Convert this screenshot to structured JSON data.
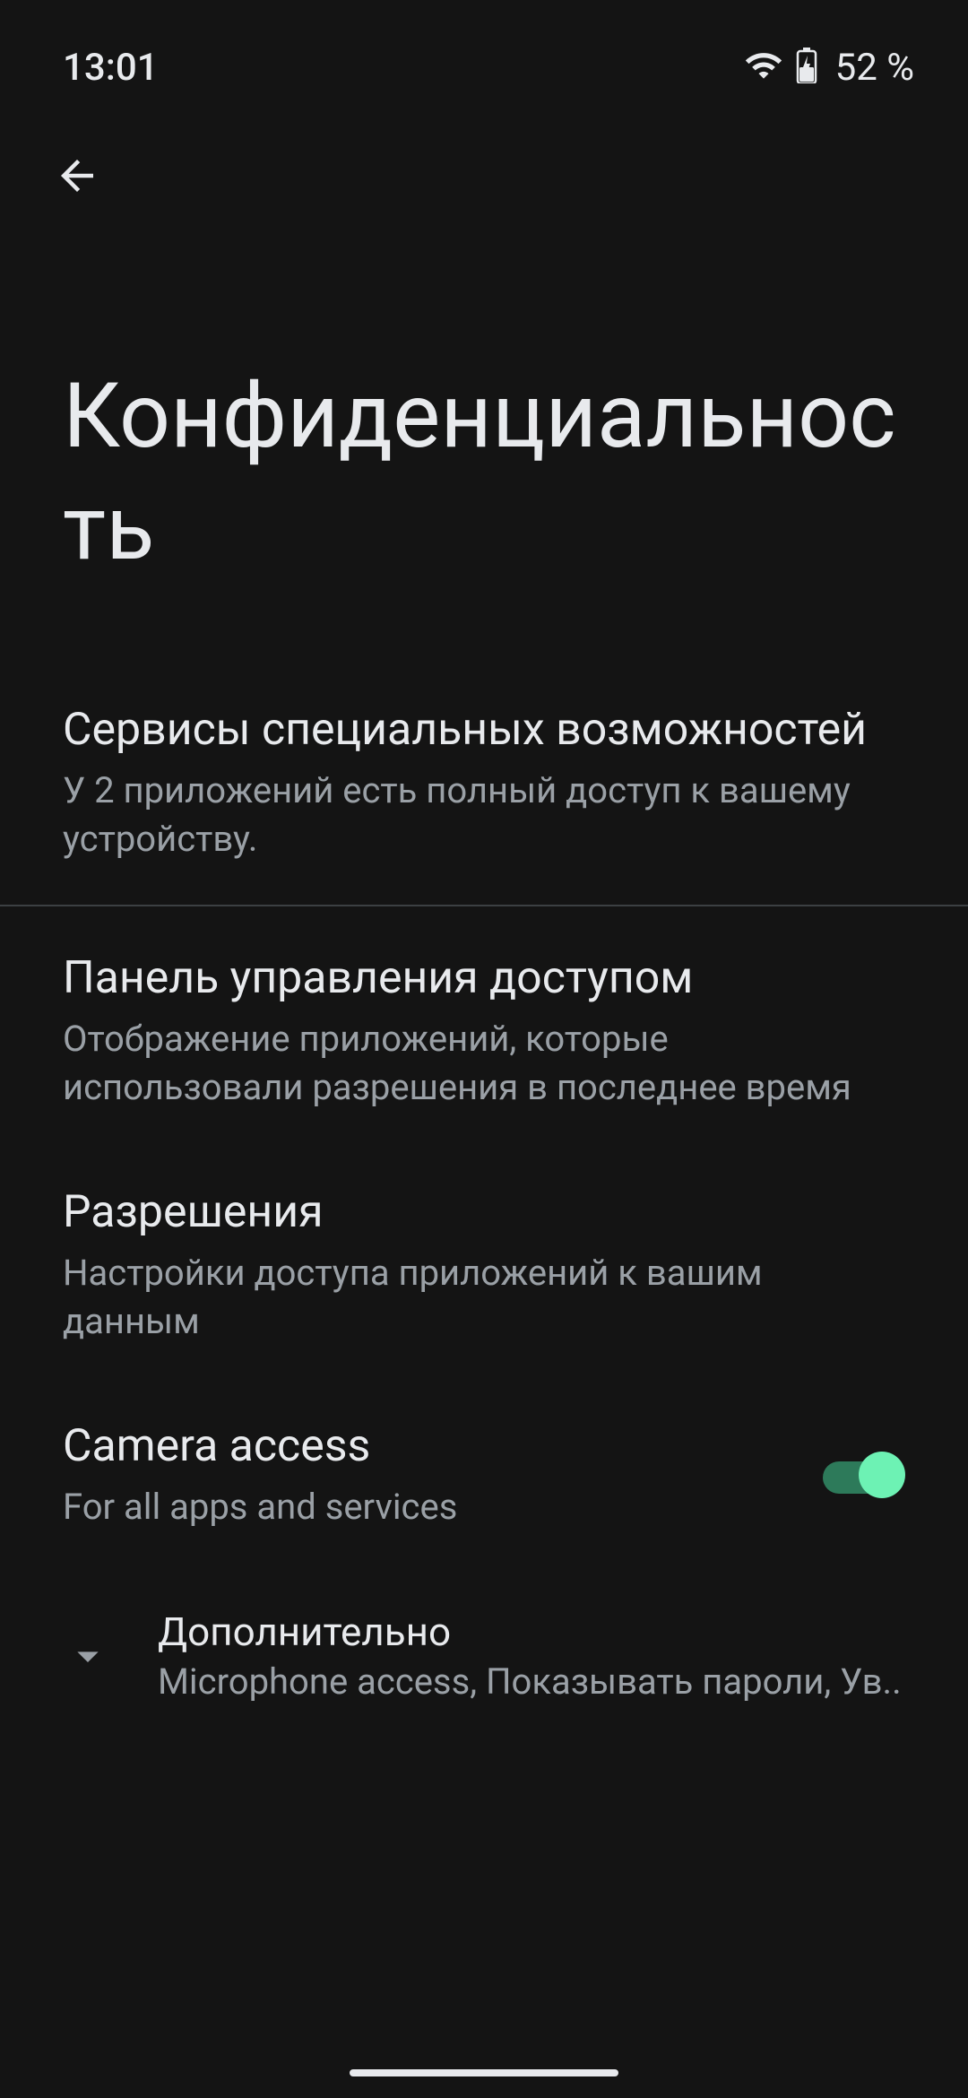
{
  "status": {
    "time": "13:01",
    "battery_pct": "52 %"
  },
  "page": {
    "title": "Конфиденциальность"
  },
  "items": {
    "accessibility": {
      "title": "Сервисы специальных возможностей",
      "subtitle": "У 2 приложений есть полный доступ к вашему устройству."
    },
    "dashboard": {
      "title": "Панель управления доступом",
      "subtitle": "Отображение приложений, которые использовали разрешения в последнее время"
    },
    "permissions": {
      "title": "Разрешения",
      "subtitle": "Настройки доступа приложений к вашим данным"
    },
    "camera": {
      "title": "Camera access",
      "subtitle": "For all apps and services",
      "enabled": true
    },
    "advanced": {
      "title": "Дополнительно",
      "subtitle": "Microphone access, Показывать пароли, Ув.."
    }
  }
}
